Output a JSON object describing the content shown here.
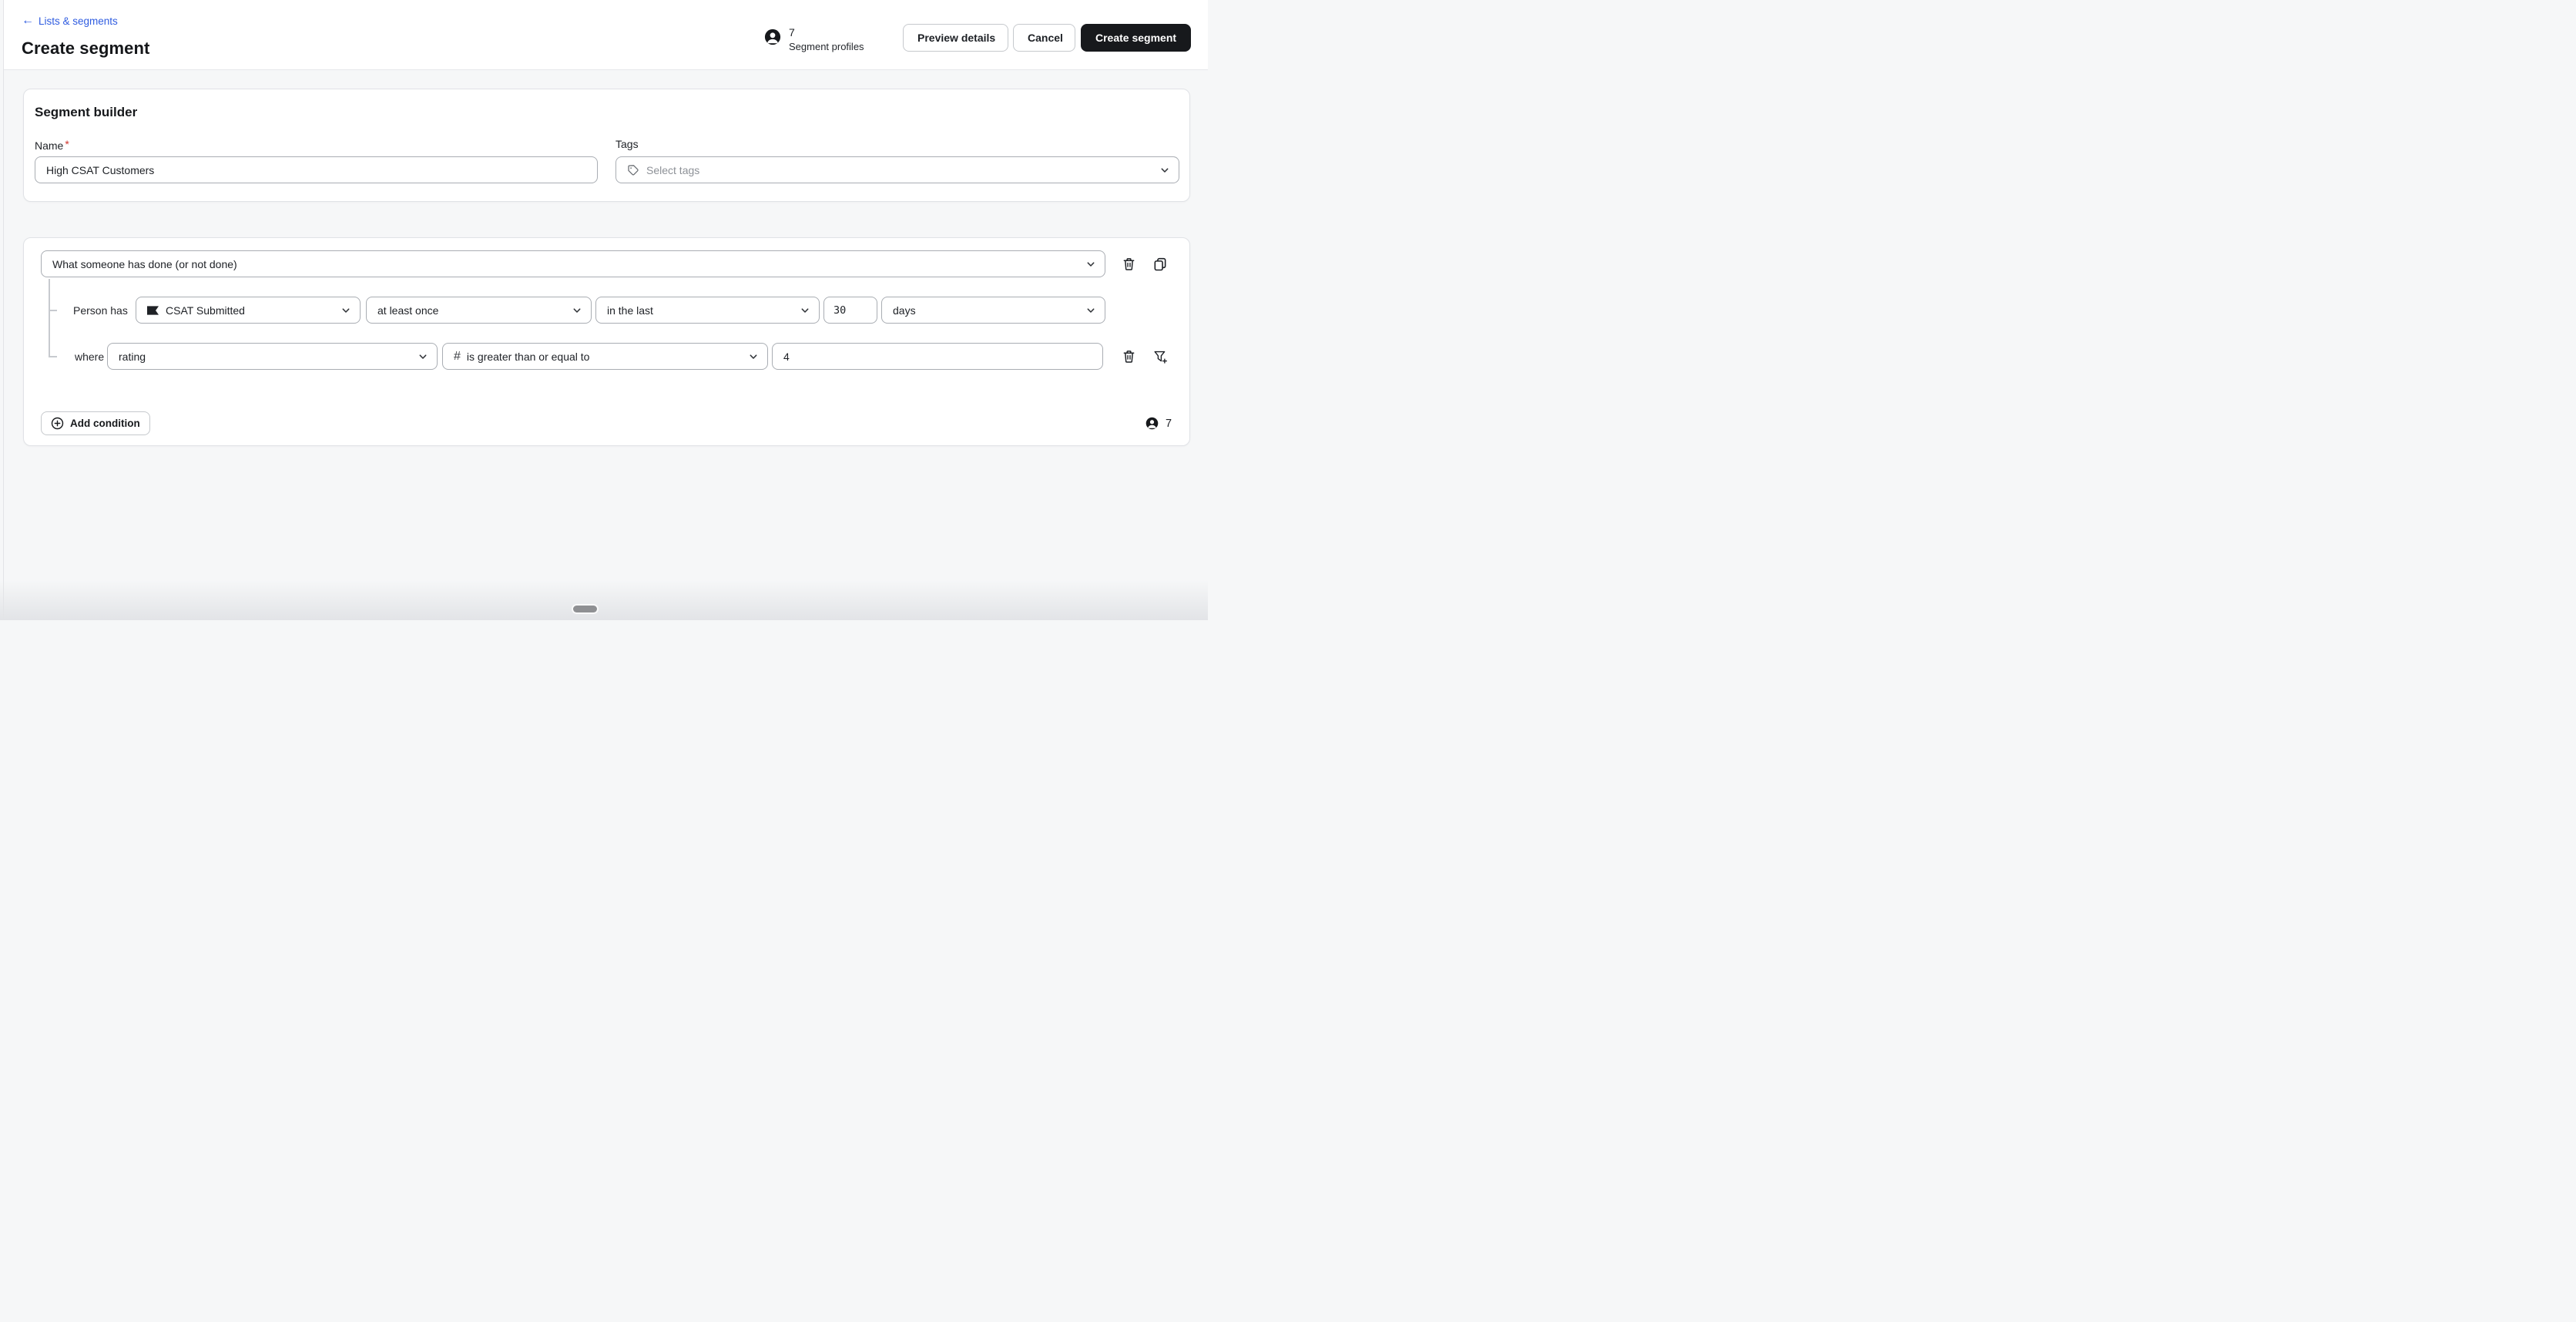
{
  "header": {
    "back_link": "Lists & segments",
    "title": "Create segment",
    "profile_count": "7",
    "profile_label": "Segment profiles",
    "preview_button": "Preview details",
    "cancel_button": "Cancel",
    "create_button": "Create segment"
  },
  "builder": {
    "title": "Segment builder",
    "name_label": "Name",
    "required_mark": "*",
    "name_value": "High CSAT Customers",
    "tags_label": "Tags",
    "tags_placeholder": "Select tags"
  },
  "condition": {
    "type_value": "What someone has done (or not done)",
    "person_has_label": "Person has",
    "metric_value": "CSAT Submitted",
    "frequency_value": "at least once",
    "timeframe_value": "in the last",
    "timeframe_number": "30",
    "timeframe_unit": "days",
    "where_label": "where",
    "property_value": "rating",
    "operator_icon_glyph": "#",
    "operator_value": "is greater than or equal to",
    "comparison_value": "4",
    "add_condition_label": "Add condition",
    "profile_count": "7"
  },
  "icons": {
    "back": "arrow-left",
    "profiles": "person-circle",
    "tags": "tag",
    "dropdown": "chevron-down",
    "delete": "trash",
    "duplicate": "copy",
    "metric": "flag",
    "numeric": "hash",
    "add": "plus-circle",
    "add_filter": "funnel-plus"
  },
  "colors": {
    "link_blue": "#2f5ce0",
    "primary_button_bg": "#17191c",
    "required_red": "#cf342c",
    "page_bg": "#f6f7f8",
    "connector_gray": "#c7cacf"
  }
}
